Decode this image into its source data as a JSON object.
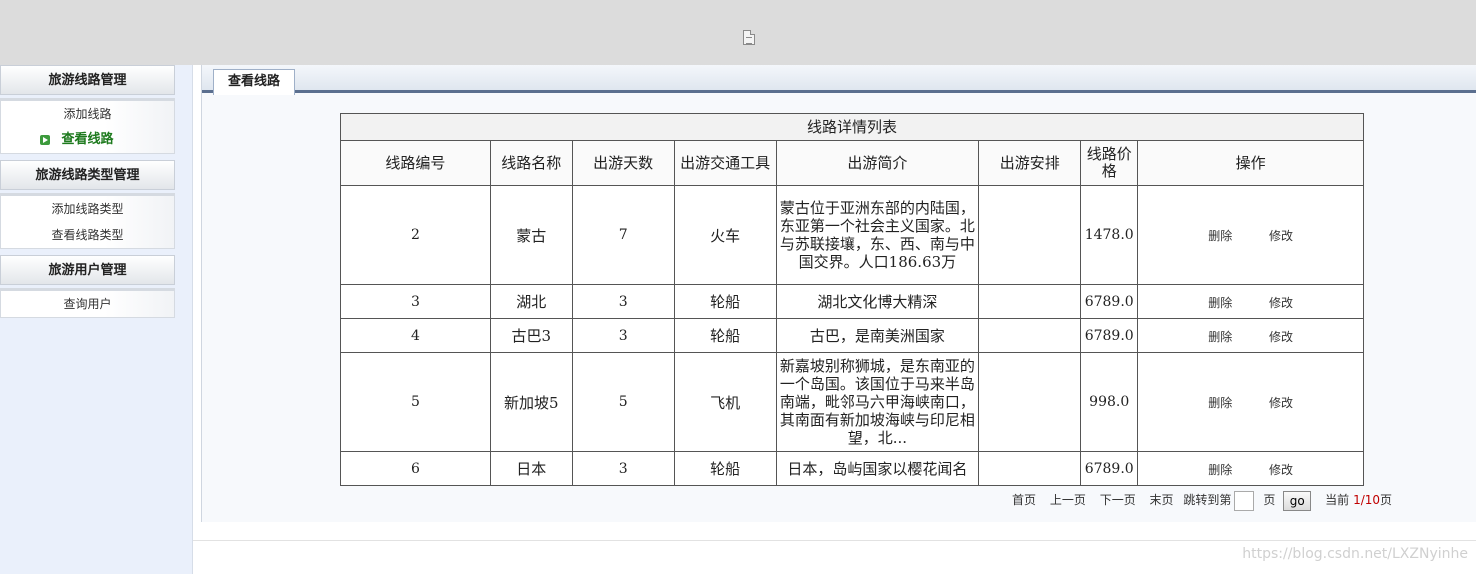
{
  "sidebar": {
    "groups": [
      {
        "title": "旅游线路管理",
        "items": [
          "添加线路",
          "查看线路"
        ]
      },
      {
        "title": "旅游线路类型管理",
        "items": [
          "添加线路类型",
          "查看线路类型"
        ]
      },
      {
        "title": "旅游用户管理",
        "items": [
          "查询用户"
        ]
      }
    ],
    "active_item": "查看线路"
  },
  "tab": {
    "label": "查看线路"
  },
  "table": {
    "caption": "线路详情列表",
    "headers": [
      "线路编号",
      "线路名称",
      "出游天数",
      "出游交通工具",
      "出游简介",
      "出游安排",
      "线路价格",
      "操作"
    ],
    "rows": [
      {
        "id": "2",
        "name": "蒙古",
        "days": "7",
        "transport": "火车",
        "desc": "蒙古位于亚洲东部的内陆国，东亚第一个社会主义国家。北与苏联接壤，东、西、南与中国交界。人口186.63万",
        "plan": "",
        "price": "1478.0",
        "op_delete": "删除",
        "op_edit": "修改"
      },
      {
        "id": "3",
        "name": "湖北",
        "days": "3",
        "transport": "轮船",
        "desc": "湖北文化博大精深",
        "plan": "",
        "price": "6789.0",
        "op_delete": "删除",
        "op_edit": "修改"
      },
      {
        "id": "4",
        "name": "古巴3",
        "days": "3",
        "transport": "轮船",
        "desc": "古巴，是南美洲国家",
        "plan": "",
        "price": "6789.0",
        "op_delete": "删除",
        "op_edit": "修改"
      },
      {
        "id": "5",
        "name": "新加坡5",
        "days": "5",
        "transport": "飞机",
        "desc": "新嘉坡别称狮城，是东南亚的一个岛国。该国位于马来半岛南端，毗邻马六甲海峡南口，其南面有新加坡海峡与印尼相望，北...",
        "plan": "",
        "price": "998.0",
        "op_delete": "删除",
        "op_edit": "修改"
      },
      {
        "id": "6",
        "name": "日本",
        "days": "3",
        "transport": "轮船",
        "desc": "日本，岛屿国家以樱花闻名",
        "plan": "",
        "price": "6789.0",
        "op_delete": "删除",
        "op_edit": "修改"
      }
    ]
  },
  "pager": {
    "first": "首页",
    "prev": "上一页",
    "next": "下一页",
    "last": "末页",
    "jump_label": "跳转到第",
    "page_unit": "页",
    "go": "go",
    "current_label": "当前",
    "current": "1/10",
    "current_suffix": "页"
  },
  "watermark": "https://blog.csdn.net/LXZNyinhe"
}
